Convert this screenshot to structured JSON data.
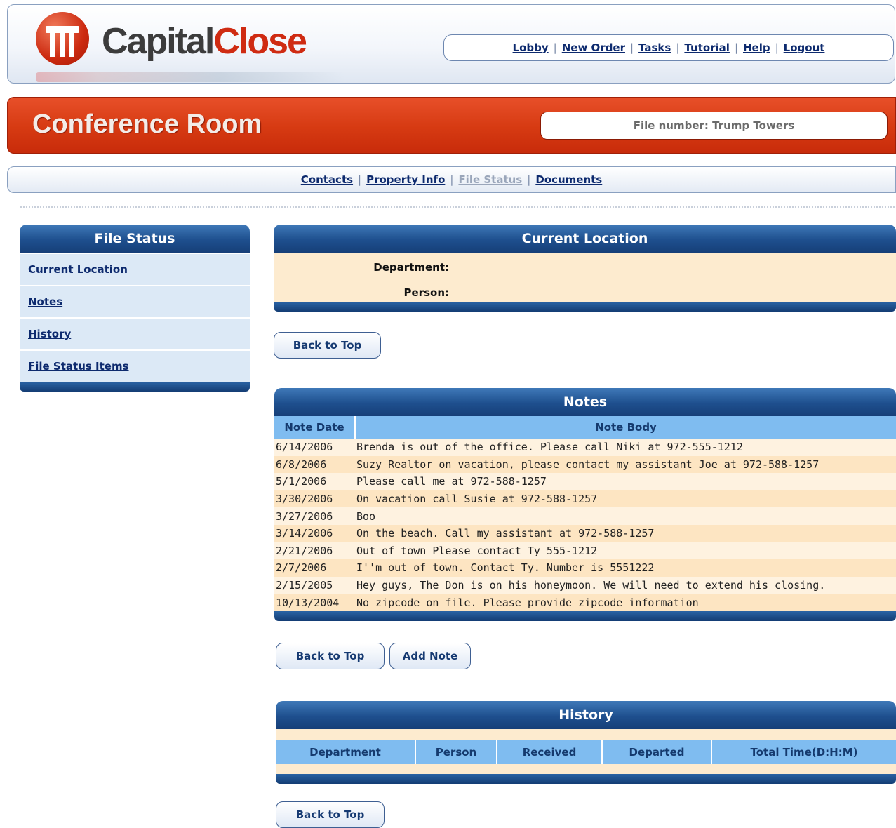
{
  "header": {
    "logo_part1": "Capital",
    "logo_part2": "Close",
    "nav": [
      "Lobby",
      "New Order",
      "Tasks",
      "Tutorial",
      "Help",
      "Logout"
    ]
  },
  "banner": {
    "title": "Conference Room",
    "file_number": "File number: Trump Towers"
  },
  "subnav": {
    "items": [
      {
        "label": "Contacts",
        "current": false
      },
      {
        "label": "Property Info",
        "current": false
      },
      {
        "label": "File Status",
        "current": true
      },
      {
        "label": "Documents",
        "current": false
      }
    ]
  },
  "sidebar": {
    "title": "File Status",
    "items": [
      "Current Location",
      "Notes",
      "History",
      "File Status Items"
    ]
  },
  "current_location": {
    "title": "Current Location",
    "department_label": "Department:",
    "person_label": "Person:"
  },
  "buttons": {
    "back_to_top": "Back to Top",
    "add_note": "Add Note"
  },
  "notes": {
    "title": "Notes",
    "columns": [
      "Note Date",
      "Note Body"
    ],
    "rows": [
      [
        "6/14/2006",
        "Brenda is out of the office. Please call Niki at 972-555-1212"
      ],
      [
        "6/8/2006",
        "Suzy Realtor on vacation, please contact my assistant Joe at 972-588-1257"
      ],
      [
        "5/1/2006",
        "Please call me at 972-588-1257"
      ],
      [
        "3/30/2006",
        "On vacation call Susie at 972-588-1257"
      ],
      [
        "3/27/2006",
        "Boo"
      ],
      [
        "3/14/2006",
        "On the beach. Call my assistant at 972-588-1257"
      ],
      [
        "2/21/2006",
        "Out of town Please contact Ty 555-1212"
      ],
      [
        "2/7/2006",
        "I''m out of town. Contact Ty. Number is 5551222"
      ],
      [
        "2/15/2005",
        "Hey guys, The Don is on his honeymoon. We will need to extend his closing."
      ],
      [
        "10/13/2004",
        "No zipcode on file. Please provide zipcode information"
      ]
    ]
  },
  "history": {
    "title": "History",
    "columns": [
      "Department",
      "Person",
      "Received",
      "Departed",
      "Total Time(D:H:M)"
    ]
  },
  "colors": {
    "banner_red": "#d63a12",
    "panel_blue": "#1e4f8e",
    "table_header_blue": "#7fbcf0",
    "body_cream": "#fdebcf"
  }
}
